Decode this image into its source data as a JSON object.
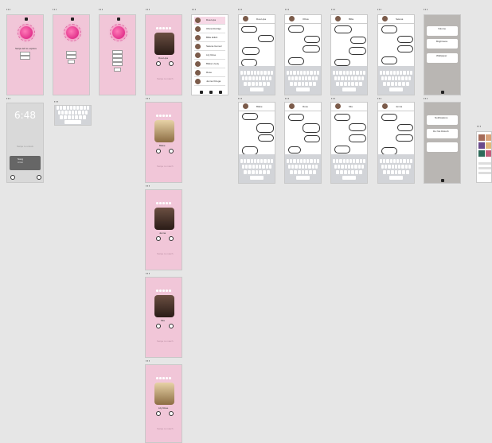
{
  "frame_labels": [
    "▪▪▪",
    "▪▪▪",
    "▪▪▪",
    "▪▪▪",
    "▪▪▪",
    "▪▪▪",
    "▪▪▪",
    "▪▪▪",
    "▪▪▪",
    "▪▪▪",
    "▪▪▪",
    "▪▪▪",
    "▪▪▪",
    "▪▪▪",
    "▪▪▪",
    "▪▪▪",
    "▪▪▪",
    "▪▪▪",
    "▪▪▪",
    "▪▪▪",
    "▪▪▪",
    "▪▪▪"
  ],
  "lock": {
    "time": "6:48",
    "hint": "Swipe to unlock",
    "track": "Song",
    "artist": "Artist"
  },
  "welcome": {
    "title": "Swipe left to explore"
  },
  "profiles": [
    {
      "name": "Dua Lipa",
      "hint": "Swipe to match"
    },
    {
      "name": "Blake",
      "hint": "Swipe to match"
    },
    {
      "name": "Jenna",
      "hint": "Swipe to match"
    },
    {
      "name": "Mia",
      "hint": "Swipe to match"
    },
    {
      "name": "Lily Rose",
      "hint": "Swipe to match"
    }
  ],
  "contacts": [
    "Dua Lipa",
    "Olivia Rodrigo",
    "Billie Eilish",
    "Selena Gomez",
    "Lily Rose",
    "Blake Lively",
    "Rose",
    "Jenna Ortega"
  ],
  "chats": [
    {
      "name": "Dua Lipa",
      "msgs": [
        "Hey there!",
        "Hi!",
        "How are you?",
        "Good, you?"
      ]
    },
    {
      "name": "Olivia",
      "msgs": [
        "Hey there!",
        "Hello",
        "What's up?",
        "Nothing"
      ]
    },
    {
      "name": "Billie",
      "msgs": [
        "Hey there!",
        "Hi",
        "Miss you",
        "Same"
      ]
    },
    {
      "name": "Selena",
      "msgs": [
        "Hey there!",
        "Hey",
        "Let's meet",
        "Sure"
      ]
    },
    {
      "name": "Blake",
      "msgs": [
        "Hey!",
        "Hello",
        "Call me",
        "Ok"
      ]
    },
    {
      "name": "Rose",
      "msgs": [
        "Hi!",
        "Hey",
        "Dinner?",
        "Yes"
      ]
    },
    {
      "name": "Mia",
      "msgs": [
        "Hey!",
        "Hi",
        "Later?",
        "Yes"
      ]
    },
    {
      "name": "Jenna",
      "msgs": [
        "Hey!",
        "Hello",
        "Movie?",
        "Sure"
      ]
    }
  ],
  "keyboard": {
    "rows": [
      "qwertyuiop",
      "asdfghjkl",
      "zxcvbnm"
    ],
    "space": "space"
  },
  "settings": {
    "volume": "Volume",
    "brightness": "Brightness",
    "wallpaper": "Wallpaper",
    "notifications": "Notifications",
    "dnd": "Do Not Disturb"
  },
  "colors": {
    "pink": "#f1c6d8",
    "grey": "#b9b6b3",
    "accent": "#d6157a"
  }
}
